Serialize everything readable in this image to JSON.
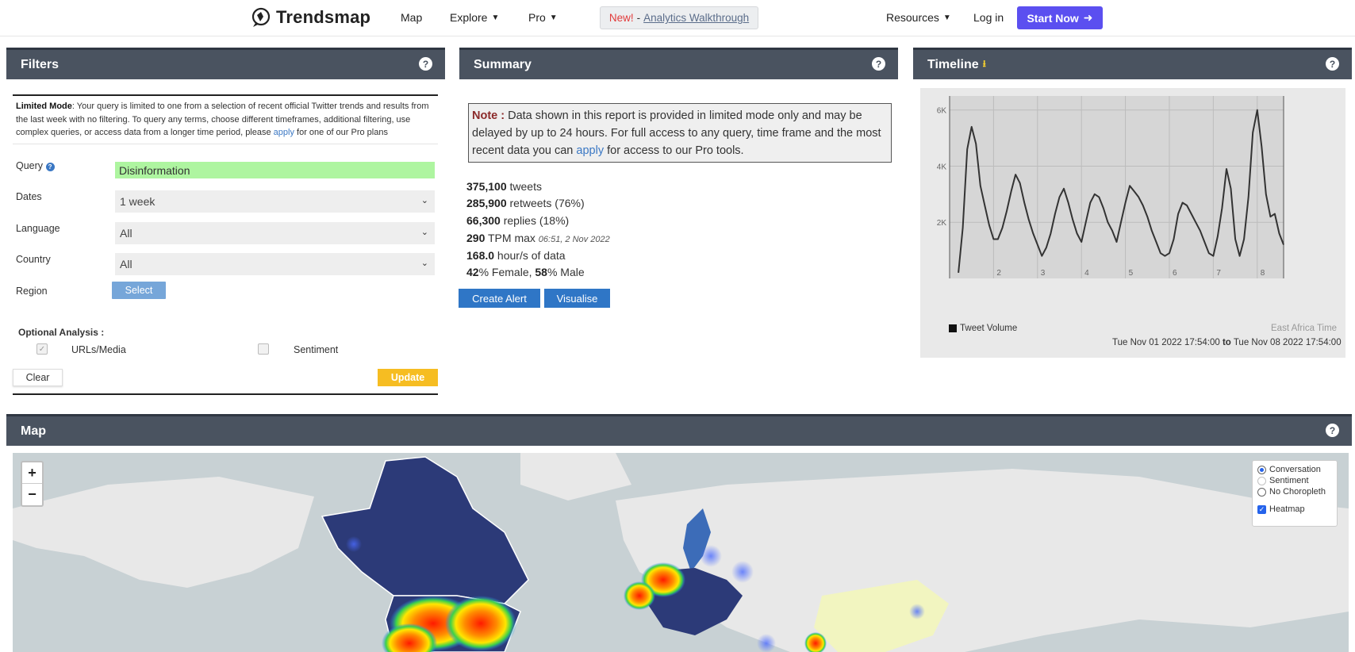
{
  "nav": {
    "brand": "Trendsmap",
    "map": "Map",
    "explore": "Explore",
    "pro": "Pro",
    "walkthrough_new": "New!",
    "walkthrough_sep": "-",
    "walkthrough_link": "Analytics Walkthrough",
    "resources": "Resources",
    "login": "Log in",
    "start": "Start Now"
  },
  "filters": {
    "title": "Filters",
    "help": "?",
    "limited_label": "Limited Mode",
    "limited_text_1": ": Your query is limited to one from a selection of recent official Twitter trends and results from the last week with no filtering. To query any terms, choose different timeframes, additional filtering, use complex queries, or access data from a longer time period, please ",
    "limited_apply": "apply",
    "limited_text_2": " for one of our Pro plans",
    "query_label": "Query",
    "query_value": "Disinformation",
    "dates_label": "Dates",
    "dates_value": "1 week",
    "language_label": "Language",
    "language_value": "All",
    "country_label": "Country",
    "country_value": "All",
    "region_label": "Region",
    "region_button": "Select",
    "optional_title": "Optional Analysis :",
    "urls_label": "URLs/Media",
    "sentiment_label": "Sentiment",
    "clear": "Clear",
    "update": "Update"
  },
  "summary": {
    "title": "Summary",
    "help": "?",
    "note_label": "Note :",
    "note_text_1": " Data shown in this report is provided in limited mode only and may be delayed by up to 24 hours. For full access to any query, time frame and the most recent data you can ",
    "note_apply": "apply",
    "note_text_2": " for access to our Pro tools.",
    "tweets_num": "375,100",
    "tweets_label": " tweets",
    "retweets_num": "285,900",
    "retweets_label": " retweets (76%)",
    "replies_num": "66,300",
    "replies_label": " replies (18%)",
    "tpm_num": "290",
    "tpm_label": " TPM max ",
    "tpm_time": "06:51, 2 Nov 2022",
    "hours_num": "168.0",
    "hours_label": " hour/s of data",
    "female_num": "42",
    "female_label": "% Female, ",
    "male_num": "58",
    "male_label": "% Male",
    "create_alert": "Create Alert",
    "visualise": "Visualise"
  },
  "timeline": {
    "title": "Timeline",
    "help": "?",
    "legend": "Tweet Volume",
    "timezone": "East Africa Time",
    "range_from": "Tue Nov 01 2022 17:54:00",
    "range_to_word": "to",
    "range_to": "Tue Nov 08 2022 17:54:00"
  },
  "chart_data": {
    "type": "line",
    "title": "",
    "xlabel": "",
    "ylabel": "",
    "ylim": [
      0,
      6500
    ],
    "x_ticks": [
      "2",
      "3",
      "4",
      "5",
      "6",
      "7",
      "8"
    ],
    "y_ticks": [
      "2K",
      "4K",
      "6K"
    ],
    "grid": true,
    "series": [
      {
        "name": "Tweet Volume",
        "x": [
          1.2,
          1.3,
          1.4,
          1.5,
          1.6,
          1.7,
          1.8,
          1.9,
          2.0,
          2.1,
          2.2,
          2.3,
          2.4,
          2.5,
          2.6,
          2.7,
          2.8,
          2.9,
          3.0,
          3.1,
          3.2,
          3.3,
          3.4,
          3.5,
          3.6,
          3.7,
          3.8,
          3.9,
          4.0,
          4.1,
          4.2,
          4.3,
          4.4,
          4.5,
          4.6,
          4.7,
          4.8,
          4.9,
          5.0,
          5.1,
          5.2,
          5.3,
          5.4,
          5.5,
          5.6,
          5.7,
          5.8,
          5.9,
          6.0,
          6.1,
          6.2,
          6.3,
          6.4,
          6.5,
          6.6,
          6.7,
          6.8,
          6.9,
          7.0,
          7.1,
          7.2,
          7.3,
          7.4,
          7.5,
          7.6,
          7.7,
          7.8,
          7.9,
          8.0,
          8.1,
          8.2,
          8.3,
          8.4,
          8.5,
          8.6
        ],
        "values": [
          200,
          1800,
          4600,
          5400,
          4800,
          3300,
          2600,
          1900,
          1400,
          1400,
          1800,
          2400,
          3100,
          3700,
          3400,
          2700,
          2100,
          1600,
          1200,
          800,
          1100,
          1600,
          2300,
          2900,
          3200,
          2700,
          2100,
          1600,
          1300,
          2000,
          2700,
          3000,
          2900,
          2500,
          2000,
          1700,
          1300,
          2000,
          2700,
          3300,
          3100,
          2900,
          2600,
          2200,
          1700,
          1300,
          900,
          800,
          900,
          1400,
          2300,
          2700,
          2600,
          2300,
          2000,
          1700,
          1300,
          900,
          800,
          1500,
          2500,
          3900,
          3200,
          1400,
          800,
          1400,
          2900,
          5200,
          6000,
          4700,
          3000,
          2200,
          2300,
          1600,
          1200
        ]
      }
    ]
  },
  "map": {
    "title": "Map",
    "help": "?",
    "zoom_in": "+",
    "zoom_out": "−",
    "layer_conversation": "Conversation",
    "layer_sentiment": "Sentiment",
    "layer_no_choropleth": "No Choropleth",
    "layer_heatmap": "Heatmap"
  },
  "colors": {
    "header_bg": "#4a5360",
    "start_btn": "#5b4ff0",
    "update_btn": "#f6bd22",
    "blue_btn": "#2f76c6",
    "query_bg": "#aef5a0"
  }
}
